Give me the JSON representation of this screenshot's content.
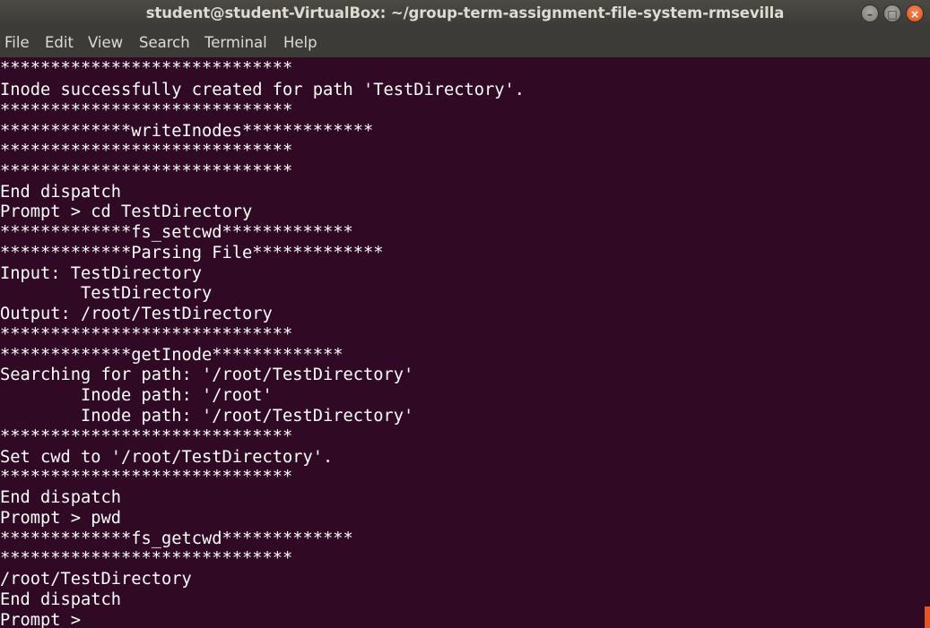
{
  "window": {
    "title": "student@student-VirtualBox: ~/group-term-assignment-file-system-rmsevilla",
    "buttons": {
      "minimize_icon": "minimize-icon",
      "maximize_icon": "maximize-icon",
      "close_icon": "close-icon"
    }
  },
  "menubar": {
    "items": [
      "File",
      "Edit",
      "View",
      "Search",
      "Terminal",
      "Help"
    ]
  },
  "terminal": {
    "lines": [
      "*****************************",
      "Inode successfully created for path 'TestDirectory'.",
      "*****************************",
      "*************writeInodes*************",
      "*****************************",
      "*****************************",
      "End dispatch",
      "Prompt > cd TestDirectory",
      "*************fs_setcwd*************",
      "*************Parsing File*************",
      "Input: TestDirectory",
      "        TestDirectory",
      "Output: /root/TestDirectory",
      "*****************************",
      "*************getInode*************",
      "Searching for path: '/root/TestDirectory'",
      "        Inode path: '/root'",
      "        Inode path: '/root/TestDirectory'",
      "*****************************",
      "Set cwd to '/root/TestDirectory'.",
      "*****************************",
      "End dispatch",
      "Prompt > pwd",
      "*************fs_getcwd*************",
      "*****************************",
      "/root/TestDirectory",
      "End dispatch",
      "Prompt > "
    ]
  },
  "colors": {
    "terminal_background": "#300a24",
    "terminal_text": "#ffffff",
    "titlebar_background": "#3c3b37",
    "close_button": "#e95420"
  }
}
